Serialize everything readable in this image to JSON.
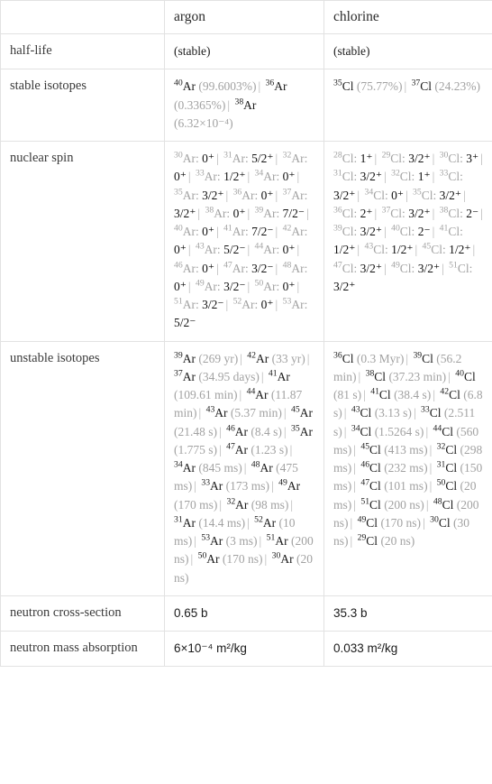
{
  "table": {
    "columns": [
      "",
      "argon",
      "chlorine"
    ],
    "rows": [
      {
        "label": "half-life",
        "argon": "(stable)",
        "chlorine": "(stable)",
        "style": "muted"
      },
      {
        "label": "stable isotopes",
        "argon_items": [
          {
            "mass": "40",
            "sym": "Ar",
            "note": "(99.6003%)"
          },
          {
            "mass": "36",
            "sym": "Ar",
            "note": "(0.3365%)"
          },
          {
            "mass": "38",
            "sym": "Ar",
            "note": "(6.32×10⁻⁴)"
          }
        ],
        "chlorine_items": [
          {
            "mass": "35",
            "sym": "Cl",
            "note": "(75.77%)"
          },
          {
            "mass": "37",
            "sym": "Cl",
            "note": "(24.23%)"
          }
        ]
      },
      {
        "label": "nuclear spin",
        "argon_items": [
          {
            "mass": "30",
            "sym": "Ar:",
            "note": "0⁺"
          },
          {
            "mass": "31",
            "sym": "Ar:",
            "note": "5/2⁺"
          },
          {
            "mass": "32",
            "sym": "Ar:",
            "note": "0⁺"
          },
          {
            "mass": "33",
            "sym": "Ar:",
            "note": "1/2⁺"
          },
          {
            "mass": "34",
            "sym": "Ar:",
            "note": "0⁺"
          },
          {
            "mass": "35",
            "sym": "Ar:",
            "note": "3/2⁺"
          },
          {
            "mass": "36",
            "sym": "Ar:",
            "note": "0⁺"
          },
          {
            "mass": "37",
            "sym": "Ar:",
            "note": "3/2⁺"
          },
          {
            "mass": "38",
            "sym": "Ar:",
            "note": "0⁺"
          },
          {
            "mass": "39",
            "sym": "Ar:",
            "note": "7/2⁻"
          },
          {
            "mass": "40",
            "sym": "Ar:",
            "note": "0⁺"
          },
          {
            "mass": "41",
            "sym": "Ar:",
            "note": "7/2⁻"
          },
          {
            "mass": "42",
            "sym": "Ar:",
            "note": "0⁺"
          },
          {
            "mass": "43",
            "sym": "Ar:",
            "note": "5/2⁻"
          },
          {
            "mass": "44",
            "sym": "Ar:",
            "note": "0⁺"
          },
          {
            "mass": "46",
            "sym": "Ar:",
            "note": "0⁺"
          },
          {
            "mass": "47",
            "sym": "Ar:",
            "note": "3/2⁻"
          },
          {
            "mass": "48",
            "sym": "Ar:",
            "note": "0⁺"
          },
          {
            "mass": "49",
            "sym": "Ar:",
            "note": "3/2⁻"
          },
          {
            "mass": "50",
            "sym": "Ar:",
            "note": "0⁺"
          },
          {
            "mass": "51",
            "sym": "Ar:",
            "note": "3/2⁻"
          },
          {
            "mass": "52",
            "sym": "Ar:",
            "note": "0⁺"
          },
          {
            "mass": "53",
            "sym": "Ar:",
            "note": "5/2⁻"
          }
        ],
        "chlorine_items": [
          {
            "mass": "28",
            "sym": "Cl:",
            "note": "1⁺"
          },
          {
            "mass": "29",
            "sym": "Cl:",
            "note": "3/2⁺"
          },
          {
            "mass": "30",
            "sym": "Cl:",
            "note": "3⁺"
          },
          {
            "mass": "31",
            "sym": "Cl:",
            "note": "3/2⁺"
          },
          {
            "mass": "32",
            "sym": "Cl:",
            "note": "1⁺"
          },
          {
            "mass": "33",
            "sym": "Cl:",
            "note": "3/2⁺"
          },
          {
            "mass": "34",
            "sym": "Cl:",
            "note": "0⁺"
          },
          {
            "mass": "35",
            "sym": "Cl:",
            "note": "3/2⁺"
          },
          {
            "mass": "36",
            "sym": "Cl:",
            "note": "2⁺"
          },
          {
            "mass": "37",
            "sym": "Cl:",
            "note": "3/2⁺"
          },
          {
            "mass": "38",
            "sym": "Cl:",
            "note": "2⁻"
          },
          {
            "mass": "39",
            "sym": "Cl:",
            "note": "3/2⁺"
          },
          {
            "mass": "40",
            "sym": "Cl:",
            "note": "2⁻"
          },
          {
            "mass": "41",
            "sym": "Cl:",
            "note": "1/2⁺"
          },
          {
            "mass": "43",
            "sym": "Cl:",
            "note": "1/2⁺"
          },
          {
            "mass": "45",
            "sym": "Cl:",
            "note": "1/2⁺"
          },
          {
            "mass": "47",
            "sym": "Cl:",
            "note": "3/2⁺"
          },
          {
            "mass": "49",
            "sym": "Cl:",
            "note": "3/2⁺"
          },
          {
            "mass": "51",
            "sym": "Cl:",
            "note": "3/2⁺"
          }
        ]
      },
      {
        "label": "unstable isotopes",
        "argon_items": [
          {
            "mass": "39",
            "sym": "Ar",
            "note": "(269 yr)"
          },
          {
            "mass": "42",
            "sym": "Ar",
            "note": "(33 yr)"
          },
          {
            "mass": "37",
            "sym": "Ar",
            "note": "(34.95 days)"
          },
          {
            "mass": "41",
            "sym": "Ar",
            "note": "(109.61 min)"
          },
          {
            "mass": "44",
            "sym": "Ar",
            "note": "(11.87 min)"
          },
          {
            "mass": "43",
            "sym": "Ar",
            "note": "(5.37 min)"
          },
          {
            "mass": "45",
            "sym": "Ar",
            "note": "(21.48 s)"
          },
          {
            "mass": "46",
            "sym": "Ar",
            "note": "(8.4 s)"
          },
          {
            "mass": "35",
            "sym": "Ar",
            "note": "(1.775 s)"
          },
          {
            "mass": "47",
            "sym": "Ar",
            "note": "(1.23 s)"
          },
          {
            "mass": "34",
            "sym": "Ar",
            "note": "(845 ms)"
          },
          {
            "mass": "48",
            "sym": "Ar",
            "note": "(475 ms)"
          },
          {
            "mass": "33",
            "sym": "Ar",
            "note": "(173 ms)"
          },
          {
            "mass": "49",
            "sym": "Ar",
            "note": "(170 ms)"
          },
          {
            "mass": "32",
            "sym": "Ar",
            "note": "(98 ms)"
          },
          {
            "mass": "31",
            "sym": "Ar",
            "note": "(14.4 ms)"
          },
          {
            "mass": "52",
            "sym": "Ar",
            "note": "(10 ms)"
          },
          {
            "mass": "53",
            "sym": "Ar",
            "note": "(3 ms)"
          },
          {
            "mass": "51",
            "sym": "Ar",
            "note": "(200 ns)"
          },
          {
            "mass": "50",
            "sym": "Ar",
            "note": "(170 ns)"
          },
          {
            "mass": "30",
            "sym": "Ar",
            "note": "(20 ns)"
          }
        ],
        "chlorine_items": [
          {
            "mass": "36",
            "sym": "Cl",
            "note": "(0.3 Myr)"
          },
          {
            "mass": "39",
            "sym": "Cl",
            "note": "(56.2 min)"
          },
          {
            "mass": "38",
            "sym": "Cl",
            "note": "(37.23 min)"
          },
          {
            "mass": "40",
            "sym": "Cl",
            "note": "(81 s)"
          },
          {
            "mass": "41",
            "sym": "Cl",
            "note": "(38.4 s)"
          },
          {
            "mass": "42",
            "sym": "Cl",
            "note": "(6.8 s)"
          },
          {
            "mass": "43",
            "sym": "Cl",
            "note": "(3.13 s)"
          },
          {
            "mass": "33",
            "sym": "Cl",
            "note": "(2.511 s)"
          },
          {
            "mass": "34",
            "sym": "Cl",
            "note": "(1.5264 s)"
          },
          {
            "mass": "44",
            "sym": "Cl",
            "note": "(560 ms)"
          },
          {
            "mass": "45",
            "sym": "Cl",
            "note": "(413 ms)"
          },
          {
            "mass": "32",
            "sym": "Cl",
            "note": "(298 ms)"
          },
          {
            "mass": "46",
            "sym": "Cl",
            "note": "(232 ms)"
          },
          {
            "mass": "31",
            "sym": "Cl",
            "note": "(150 ms)"
          },
          {
            "mass": "47",
            "sym": "Cl",
            "note": "(101 ms)"
          },
          {
            "mass": "50",
            "sym": "Cl",
            "note": "(20 ms)"
          },
          {
            "mass": "51",
            "sym": "Cl",
            "note": "(200 ns)"
          },
          {
            "mass": "48",
            "sym": "Cl",
            "note": "(200 ns)"
          },
          {
            "mass": "49",
            "sym": "Cl",
            "note": "(170 ns)"
          },
          {
            "mass": "30",
            "sym": "Cl",
            "note": "(30 ns)"
          },
          {
            "mass": "29",
            "sym": "Cl",
            "note": "(20 ns)"
          }
        ]
      },
      {
        "label": "neutron cross-section",
        "argon": "0.65 b",
        "chlorine": "35.3 b",
        "style": "units"
      },
      {
        "label": "neutron mass absorption",
        "argon": "6×10⁻⁴ m²/kg",
        "chlorine": "0.033 m²/kg",
        "style": "units"
      }
    ]
  },
  "colors": {
    "border": "#e2e2e2",
    "text": "#1a1a1a",
    "muted": "#a2a2a2",
    "label": "#3b3b3b"
  }
}
